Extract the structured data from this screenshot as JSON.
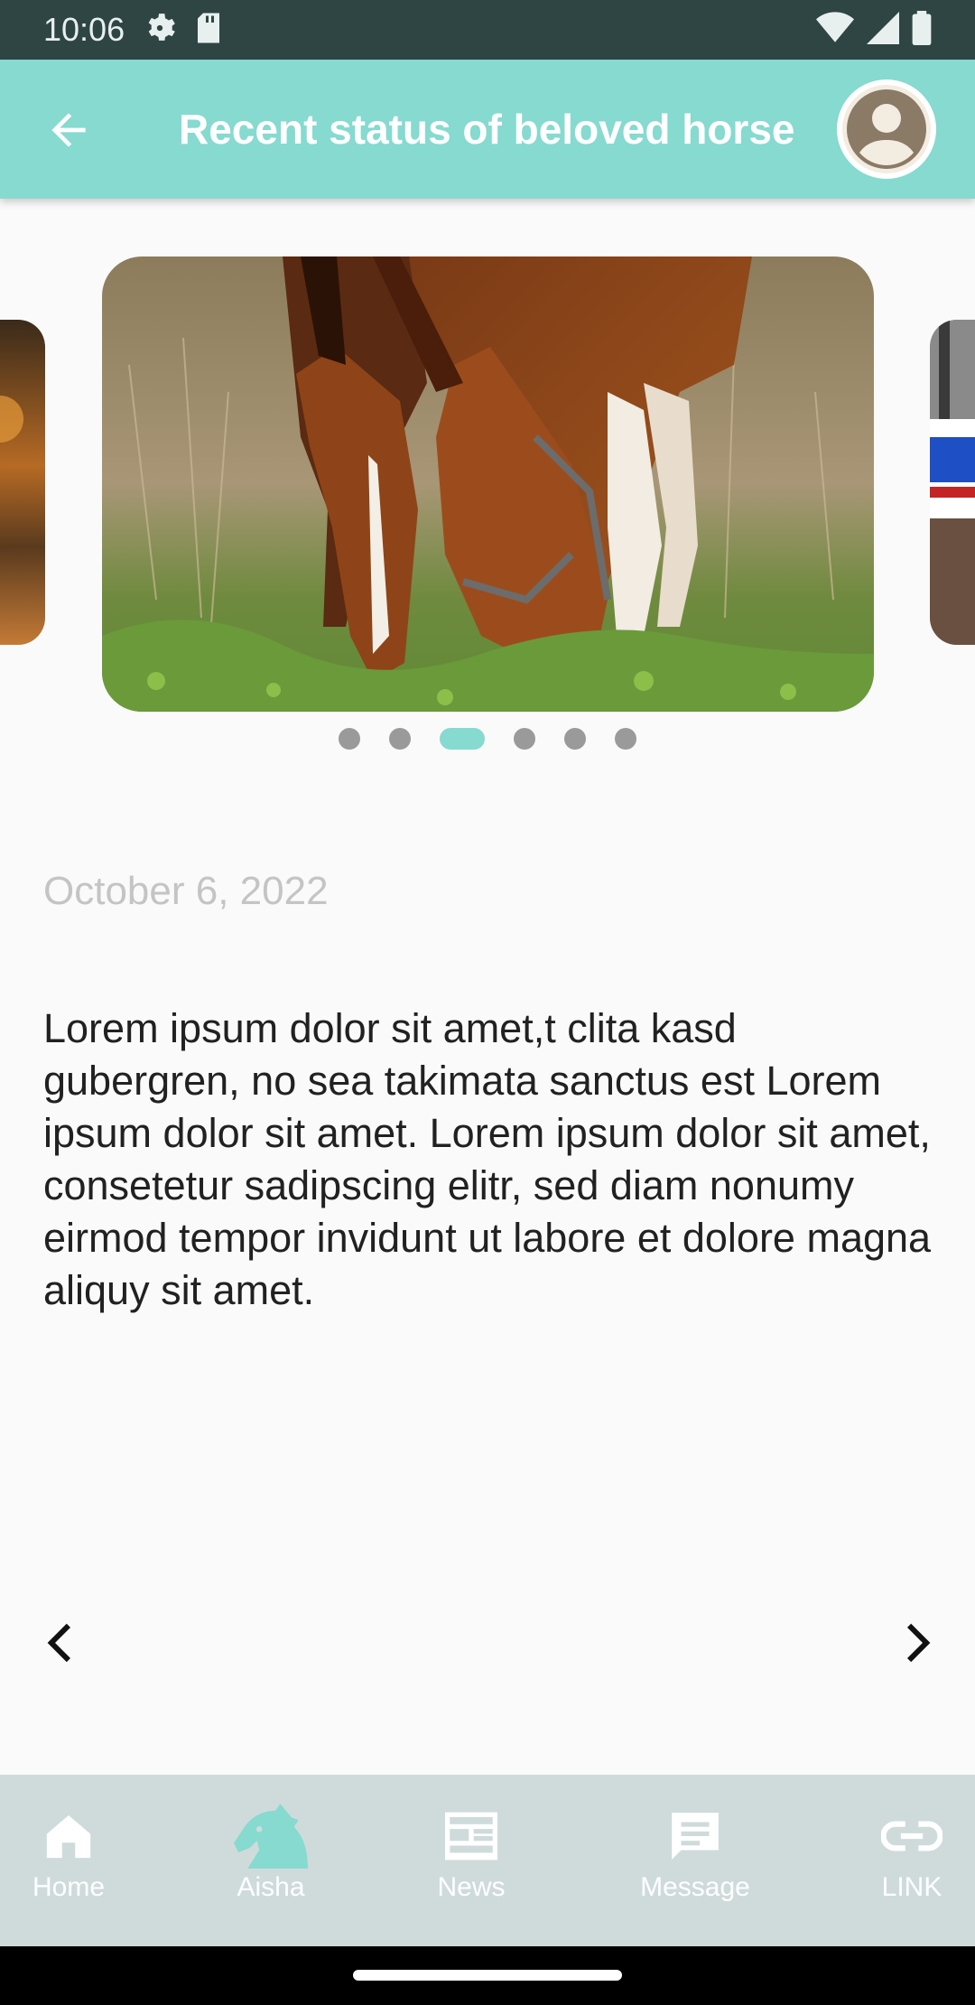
{
  "status_bar": {
    "time": "10:06",
    "icons": [
      "gear-icon",
      "sd-card-icon",
      "wifi-icon",
      "signal-icon",
      "battery-icon"
    ]
  },
  "app_bar": {
    "title": "Recent status of beloved horse",
    "back_icon": "arrow-left-icon",
    "avatar_icon": "account-circle-icon",
    "color": "#86dad0"
  },
  "carousel": {
    "slide_count": 6,
    "active_index": 2,
    "accent_color": "#86dad0"
  },
  "post": {
    "date": "October 6, 2022",
    "body": "Lorem ipsum dolor sit amet,t clita kasd gubergren, no sea takimata sanctus est Lorem ipsum dolor sit amet. Lorem ipsum dolor sit amet, consetetur sadipscing elitr, sed diam nonumy eirmod tempor invidunt ut labore et dolore magna aliquy sit amet."
  },
  "pager": {
    "prev_icon": "chevron-left-icon",
    "next_icon": "chevron-right-icon"
  },
  "bottom_nav": {
    "background": "#cfdbdb",
    "active_color": "#86dad0",
    "items": [
      {
        "label": "Home",
        "icon": "home-icon",
        "active": false
      },
      {
        "label": "Aisha",
        "icon": "horse-icon",
        "active": true
      },
      {
        "label": "News",
        "icon": "news-icon",
        "active": false
      },
      {
        "label": "Message",
        "icon": "message-icon",
        "active": false
      },
      {
        "label": "LINK",
        "icon": "link-icon",
        "active": false
      }
    ]
  }
}
